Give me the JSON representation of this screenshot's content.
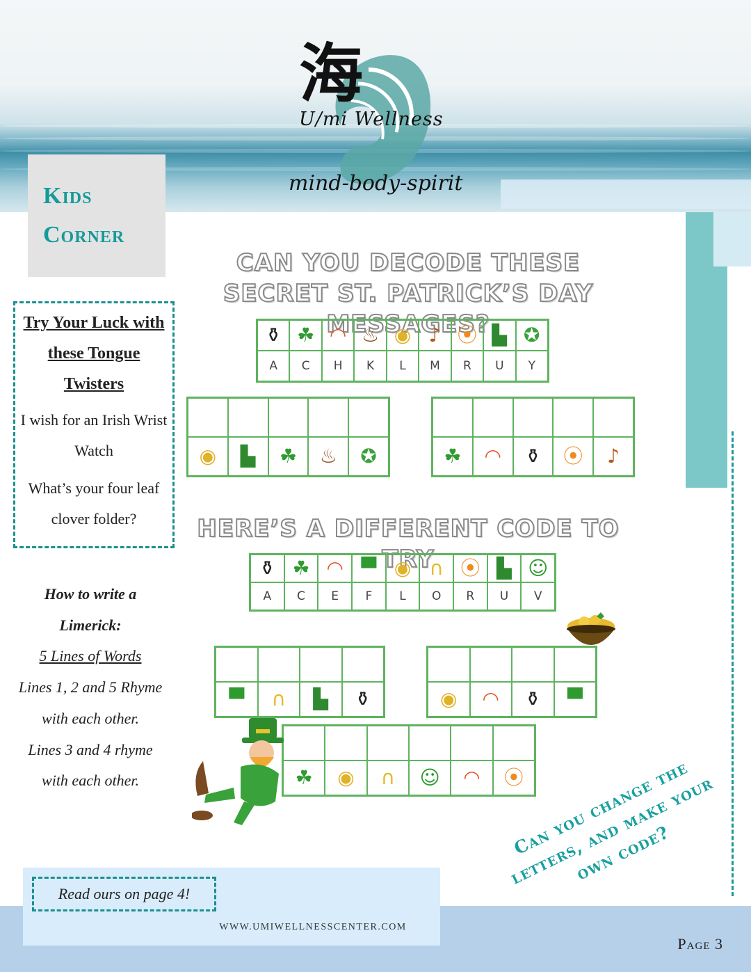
{
  "header": {
    "logo_kanji": "海",
    "logo_name": "U/mi Wellness",
    "tagline": "mind-body-spirit"
  },
  "section_tab": {
    "line1": "Kids",
    "line2": "Corner"
  },
  "tongue_twisters": {
    "title": "Try Your Luck with these Tongue Twisters",
    "items": [
      "I wish for an Irish Wrist Watch",
      "What’s your four leaf clover folder?"
    ]
  },
  "limerick": {
    "heading": "How to write a Limerick:",
    "lines": [
      "5 Lines of Words",
      "Lines 1, 2 and 5 Rhyme with each other.",
      "Lines 3 and 4 rhyme with each other."
    ]
  },
  "read_note": "Read ours on page 4!",
  "footer": {
    "website": "WWW.UMIWELLNESSCENTER.COM",
    "page": "Page 3"
  },
  "puzzle1": {
    "heading": "CAN YOU DECODE THESE SECRET ST. PATRICK’S DAY MESSAGES?",
    "key_icons": [
      "pot-of-gold",
      "shamrock",
      "rainbow",
      "pipe",
      "gold-coins",
      "harp",
      "balloons",
      "leprechaun-shoe",
      "ribbon"
    ],
    "key_letters": [
      "A",
      "C",
      "H",
      "K",
      "L",
      "M",
      "R",
      "U",
      "Y"
    ],
    "word1_icons": [
      "gold-coins",
      "leprechaun-shoe",
      "shamrock",
      "pipe",
      "ribbon"
    ],
    "word2_icons": [
      "shamrock",
      "rainbow",
      "pot-of-gold",
      "balloons",
      "harp"
    ]
  },
  "puzzle2": {
    "heading": "HERE’S A DIFFERENT CODE TO TRY",
    "key_icons": [
      "pot-of-gold",
      "shamrock",
      "rainbow",
      "green-hat",
      "gold-coins",
      "horseshoe",
      "balloons",
      "leprechaun-shoe",
      "leprechaun"
    ],
    "key_letters": [
      "A",
      "C",
      "E",
      "F",
      "L",
      "O",
      "R",
      "U",
      "V"
    ],
    "word1_icons": [
      "green-hat",
      "horseshoe",
      "leprechaun-shoe",
      "pot-of-gold"
    ],
    "word2_icons": [
      "gold-coins",
      "rainbow",
      "pot-of-gold",
      "green-hat"
    ],
    "word3_icons": [
      "shamrock",
      "gold-coins",
      "horseshoe",
      "leprechaun",
      "rainbow",
      "balloons"
    ]
  },
  "challenge_text": "Can you change the letters, and make your own code?",
  "colors": {
    "teal": "#159a9a",
    "grid_green": "#5fb35f",
    "footer_blue": "#b7d0ea"
  }
}
